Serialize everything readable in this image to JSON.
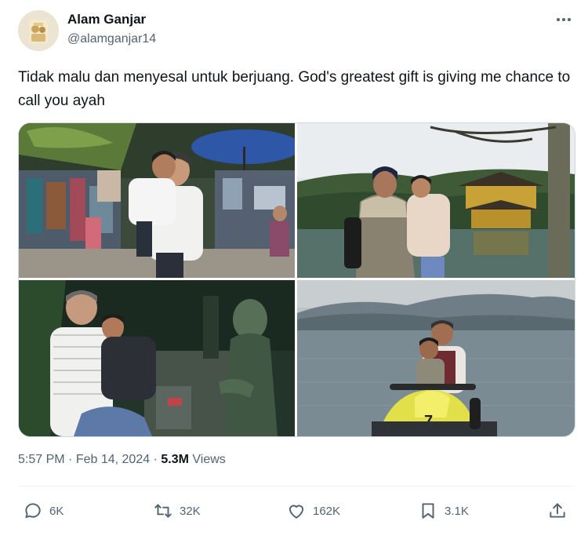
{
  "author": {
    "display_name": "Alam Ganjar",
    "handle": "@alamganjar14"
  },
  "tweet": {
    "text": "Tidak malu dan menyesal untuk berjuang. God's greatest gift is giving me chance to call you ayah"
  },
  "meta": {
    "time": "5:57 PM",
    "separator": "·",
    "date": "Feb 14, 2024",
    "views_count": "5.3M",
    "views_label": "Views"
  },
  "actions": {
    "reply_count": "6K",
    "retweet_count": "32K",
    "like_count": "162K",
    "bookmark_count": "3.1K"
  },
  "icons": {
    "more": "more-horizontal-icon",
    "reply": "reply-icon",
    "retweet": "retweet-icon",
    "like": "heart-icon",
    "bookmark": "bookmark-icon",
    "share": "share-icon"
  },
  "colors": {
    "text_primary": "#0f1419",
    "text_secondary": "#536471",
    "border": "#cfd9de",
    "divider": "#eff3f4"
  }
}
